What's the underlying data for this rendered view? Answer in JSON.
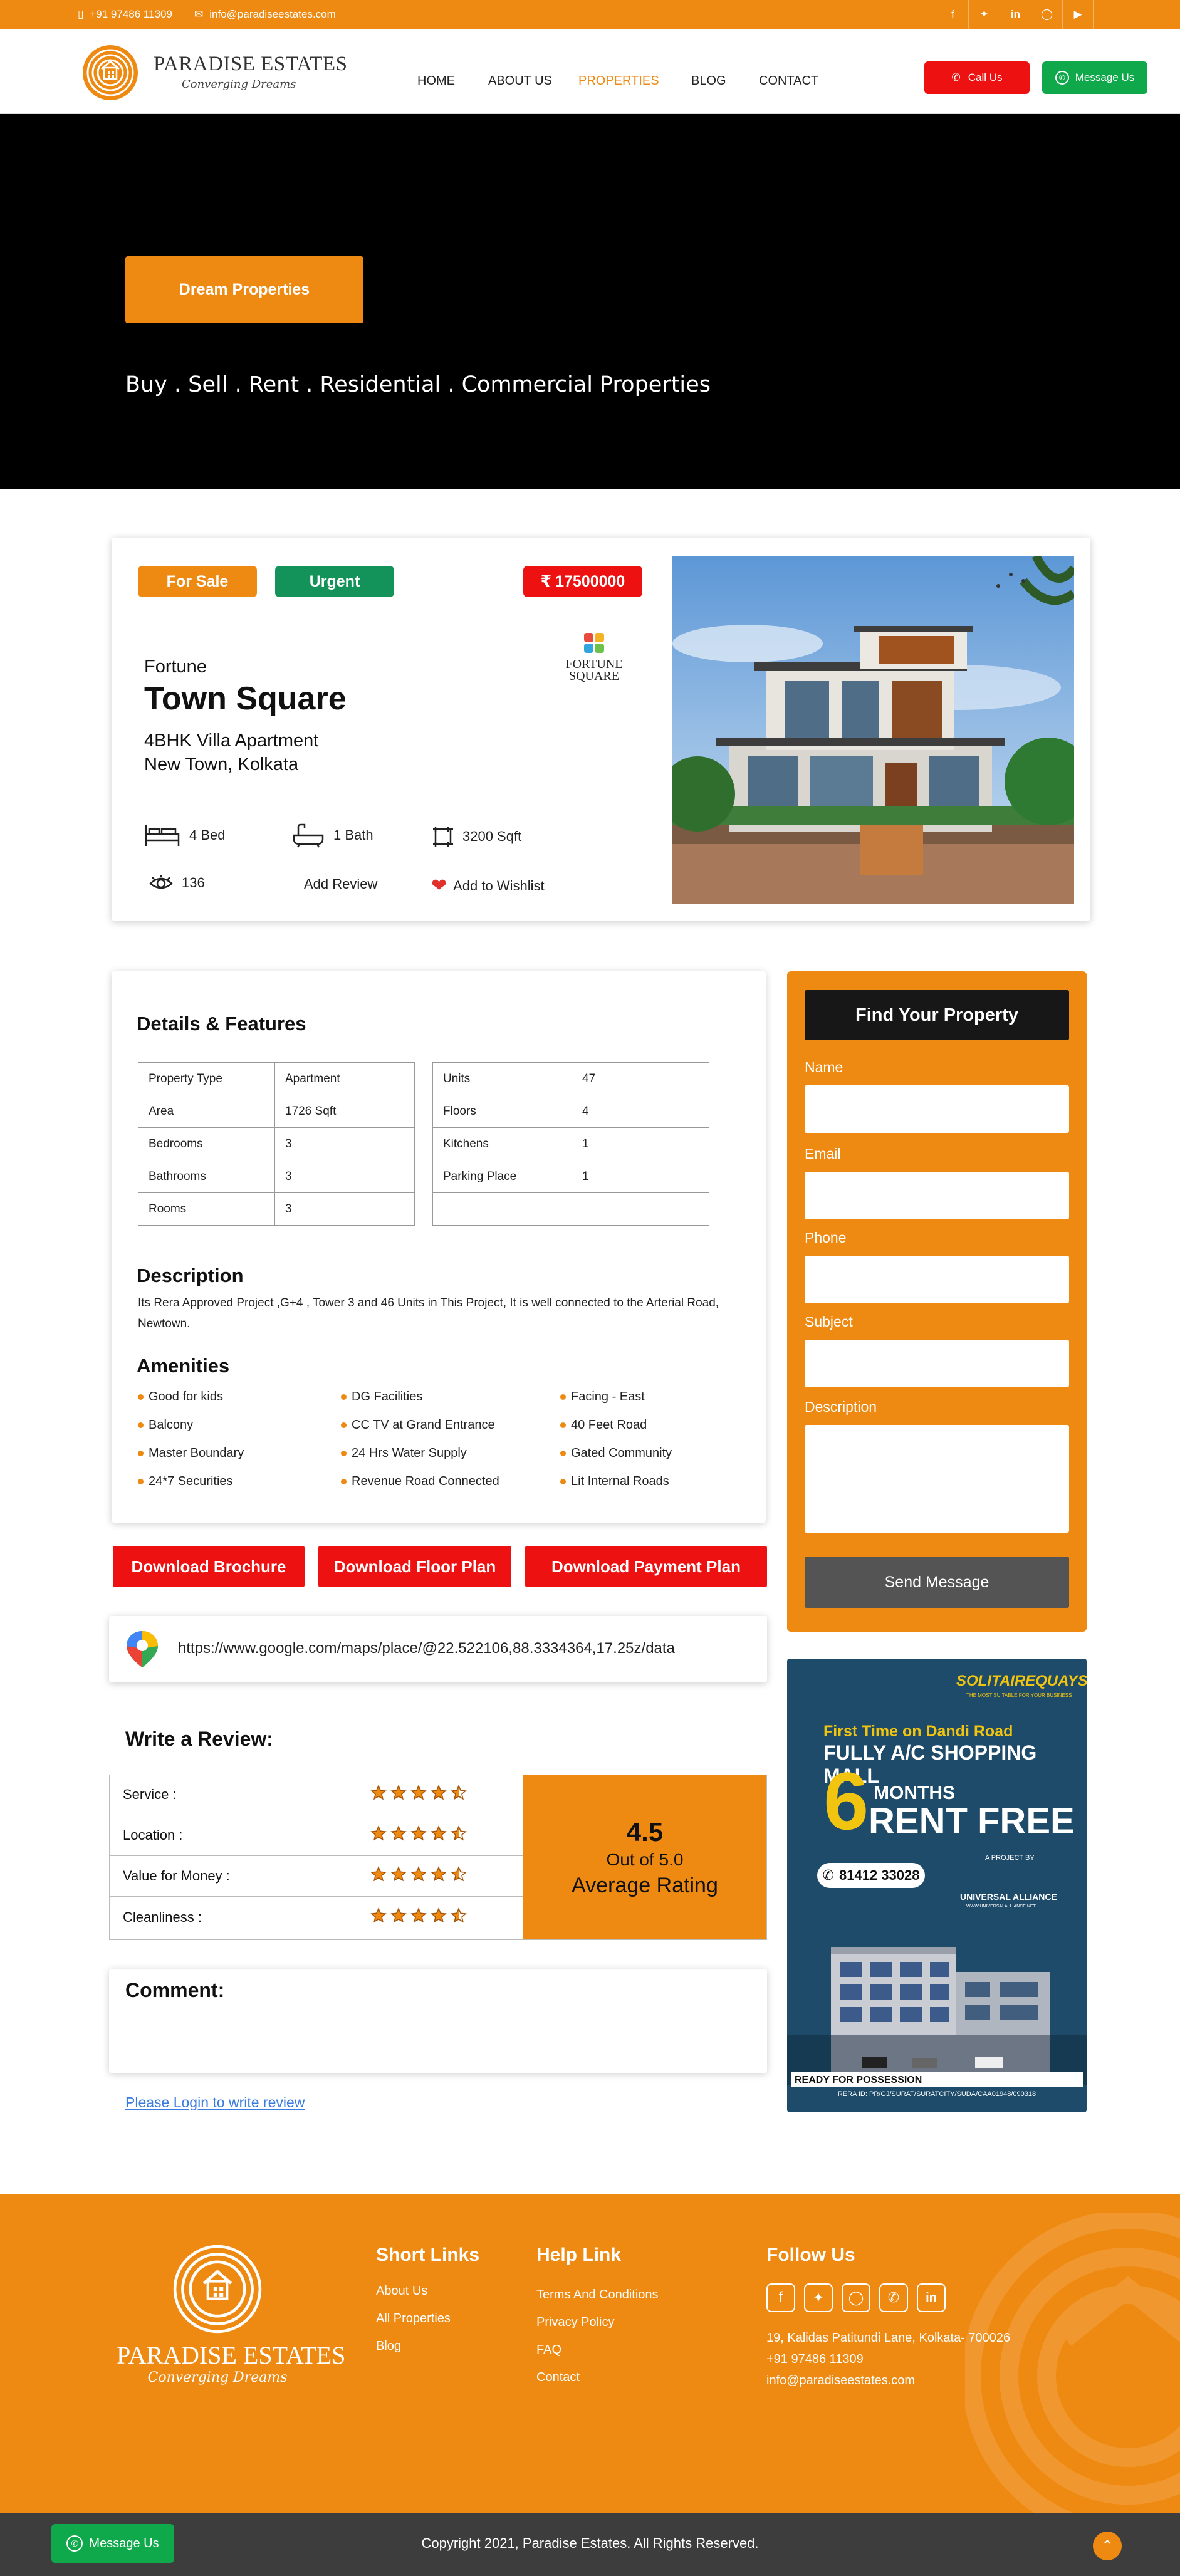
{
  "topbar": {
    "phone": "+91 97486 11309",
    "email": "info@paradiseestates.com"
  },
  "brand": {
    "name": "PARADISE ESTATES",
    "tagline": "Converging Dreams"
  },
  "nav": [
    {
      "label": "HOME"
    },
    {
      "label": "ABOUT US"
    },
    {
      "label": "PROPERTIES"
    },
    {
      "label": "BLOG"
    },
    {
      "label": "CONTACT"
    }
  ],
  "header": {
    "call_label": "Call Us",
    "message_label": "Message Us"
  },
  "hero": {
    "button_label": "Dream Properties",
    "subtitle": "Buy . Sell . Rent . Residential . Commercial Properties"
  },
  "property": {
    "status": "For Sale",
    "priority": "Urgent",
    "price": "17500000",
    "developer": "Fortune",
    "name": "Town Square",
    "type": "4BHK Villa Apartment",
    "location": "New Town, Kolkata",
    "logo_text": "FORTUNE SQUARE",
    "beds": "4 Bed",
    "baths": "1 Bath",
    "area": "3200 Sqft",
    "views": "136",
    "add_review": "Add Review",
    "wishlist": "Add to Wishlist"
  },
  "details": {
    "title": "Details & Features",
    "left": [
      [
        "Property Type",
        "Apartment"
      ],
      [
        "Area",
        "1726 Sqft"
      ],
      [
        "Bedrooms",
        "3"
      ],
      [
        "Bathrooms",
        "3"
      ],
      [
        "Rooms",
        "3"
      ]
    ],
    "right": [
      [
        "Units",
        "47"
      ],
      [
        "Floors",
        "4"
      ],
      [
        "Kitchens",
        "1"
      ],
      [
        "Parking Place",
        "1"
      ],
      [
        "",
        ""
      ]
    ],
    "description_title": "Description",
    "description": "Its Rera Approved Project ,G+4 , Tower 3 and 46 Units in This Project, It is well connected to the Arterial Road, Newtown.",
    "amenities_title": "Amenities",
    "amenities": [
      "Good for kids",
      "DG Facilities",
      "Facing - East",
      "Balcony",
      "CC TV at Grand Entrance",
      "40 Feet Road",
      "Master Boundary",
      "24 Hrs Water Supply",
      "Gated Community",
      "24*7 Securities",
      "Revenue Road Connected",
      "Lit Internal Roads"
    ]
  },
  "downloads": {
    "brochure": "Download Brochure",
    "floor_plan": "Download Floor Plan",
    "payment_plan": "Download Payment Plan"
  },
  "map": {
    "url": "https://www.google.com/maps/place/@22.522106,88.3334364,17.25z/data"
  },
  "form": {
    "title": "Find Your Property",
    "name_label": "Name",
    "email_label": "Email",
    "phone_label": "Phone",
    "subject_label": "Subject",
    "description_label": "Description",
    "submit_label": "Send Message"
  },
  "ad": {
    "brand": "SOLITAIREQUAYS",
    "brand_sub": "THE MOST SUITABLE FOR YOUR BUSINESS",
    "line1": "First Time on Dandi Road",
    "line2": "FULLY A/C SHOPPING MALL",
    "big_number": "6",
    "months": "MONTHS",
    "rent_free": "RENT FREE",
    "phone": "81412 33028",
    "project_by": "A PROJECT BY",
    "developer": "UNIVERSAL ALLIANCE",
    "developer_url": "WWW.UNIVERSALALLIANCE.NET",
    "possession": "READY FOR POSSESSION",
    "rera": "RERA ID: PR/GJ/SURAT/SURATCITY/SUDA/CAA01948/090318"
  },
  "review": {
    "title": "Write a Review:",
    "criteria": [
      {
        "label": "Service :",
        "stars": 4.5
      },
      {
        "label": "Location :",
        "stars": 4.5
      },
      {
        "label": "Value for Money :",
        "stars": 4.5
      },
      {
        "label": "Cleanliness :",
        "stars": 4.5
      }
    ],
    "score": "4.5",
    "out_of": "Out of 5.0",
    "average_label": "Average Rating",
    "comment_label": "Comment:",
    "login_link": "Please Login to write review"
  },
  "footer": {
    "short_links_title": "Short Links",
    "short_links": [
      "About Us",
      "All Properties",
      "Blog"
    ],
    "help_title": "Help Link",
    "help_links": [
      "Terms And Conditions",
      "Privacy Policy",
      "FAQ",
      "Contact"
    ],
    "follow_title": "Follow Us",
    "address": "19, Kalidas Patitundi Lane, Kolkata- 700026",
    "phone": "+91 97486 11309",
    "email": "info@paradiseestates.com",
    "copyright": "Copyright 2021, Paradise Estates. All Rights Reserved.",
    "message_label": "Message Us"
  },
  "colors": {
    "accent": "#ee8a12",
    "red": "#ee1111",
    "green": "#0fa84a",
    "dark": "#3d3d3d"
  }
}
